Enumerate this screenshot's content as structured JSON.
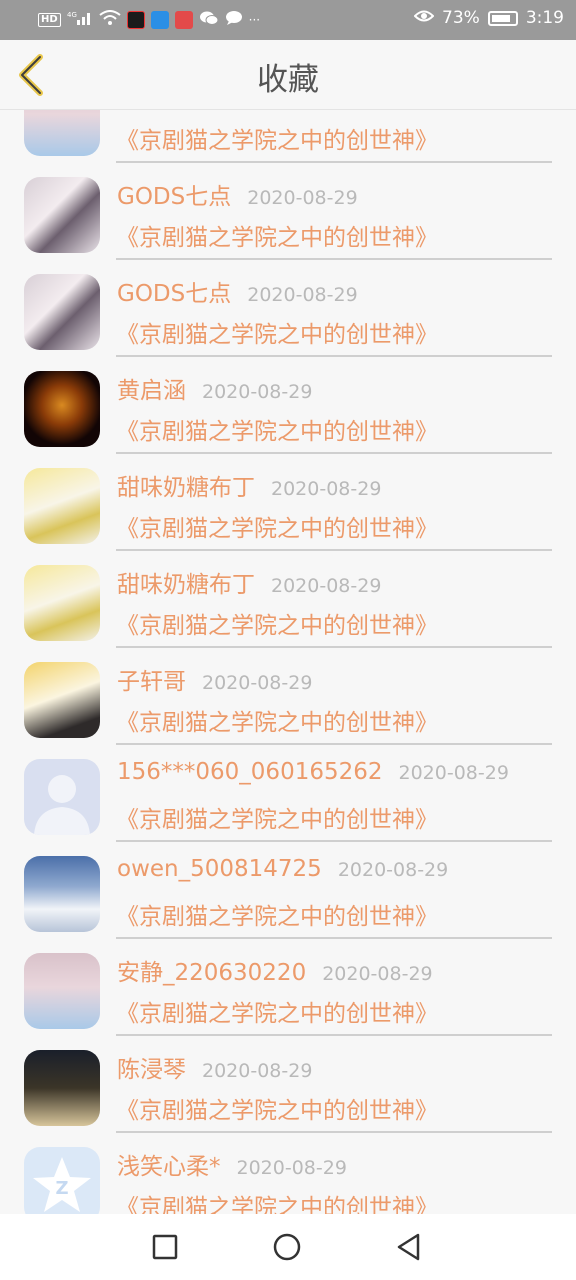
{
  "status_bar": {
    "network_label": "HD",
    "signal_label": "4G",
    "battery_percent": "73%",
    "time": "3:19",
    "more_label": "···"
  },
  "header": {
    "title": "收藏"
  },
  "favorites": [
    {
      "user": "",
      "date": "",
      "work": "《京剧猫之学院之中的创世神》",
      "avatar": "av-pastel"
    },
    {
      "user": "GODS七点",
      "date": "2020-08-29",
      "work": "《京剧猫之学院之中的创世神》",
      "avatar": "av-anime"
    },
    {
      "user": "GODS七点",
      "date": "2020-08-29",
      "work": "《京剧猫之学院之中的创世神》",
      "avatar": "av-anime"
    },
    {
      "user": "黄启涵",
      "date": "2020-08-29",
      "work": "《京剧猫之学院之中的创世神》",
      "avatar": "av-dragon"
    },
    {
      "user": "甜味奶糖布丁",
      "date": "2020-08-29",
      "work": "《京剧猫之学院之中的创世神》",
      "avatar": "av-blonde"
    },
    {
      "user": "甜味奶糖布丁",
      "date": "2020-08-29",
      "work": "《京剧猫之学院之中的创世神》",
      "avatar": "av-blonde"
    },
    {
      "user": "子轩哥",
      "date": "2020-08-29",
      "work": "《京剧猫之学院之中的创世神》",
      "avatar": "av-cat"
    },
    {
      "user": "156***060_060165262",
      "date": "2020-08-29",
      "work": "《京剧猫之学院之中的创世神》",
      "avatar": "av-default"
    },
    {
      "user": "owen_500814725",
      "date": "2020-08-29",
      "work": "《京剧猫之学院之中的创世神》",
      "avatar": "av-snow"
    },
    {
      "user": "安静_220630220",
      "date": "2020-08-29",
      "work": "《京剧猫之学院之中的创世神》",
      "avatar": "av-pastel"
    },
    {
      "user": "陈浸琴",
      "date": "2020-08-29",
      "work": "《京剧猫之学院之中的创世神》",
      "avatar": "av-couple"
    },
    {
      "user": "浅笑心柔*",
      "date": "2020-08-29",
      "work": "《京剧猫之学院之中的创世神》",
      "avatar": "av-star"
    }
  ],
  "colors": {
    "accent": "#ec9a6a",
    "date": "#b9b9b9",
    "back_arrow": "#e8c64a"
  }
}
